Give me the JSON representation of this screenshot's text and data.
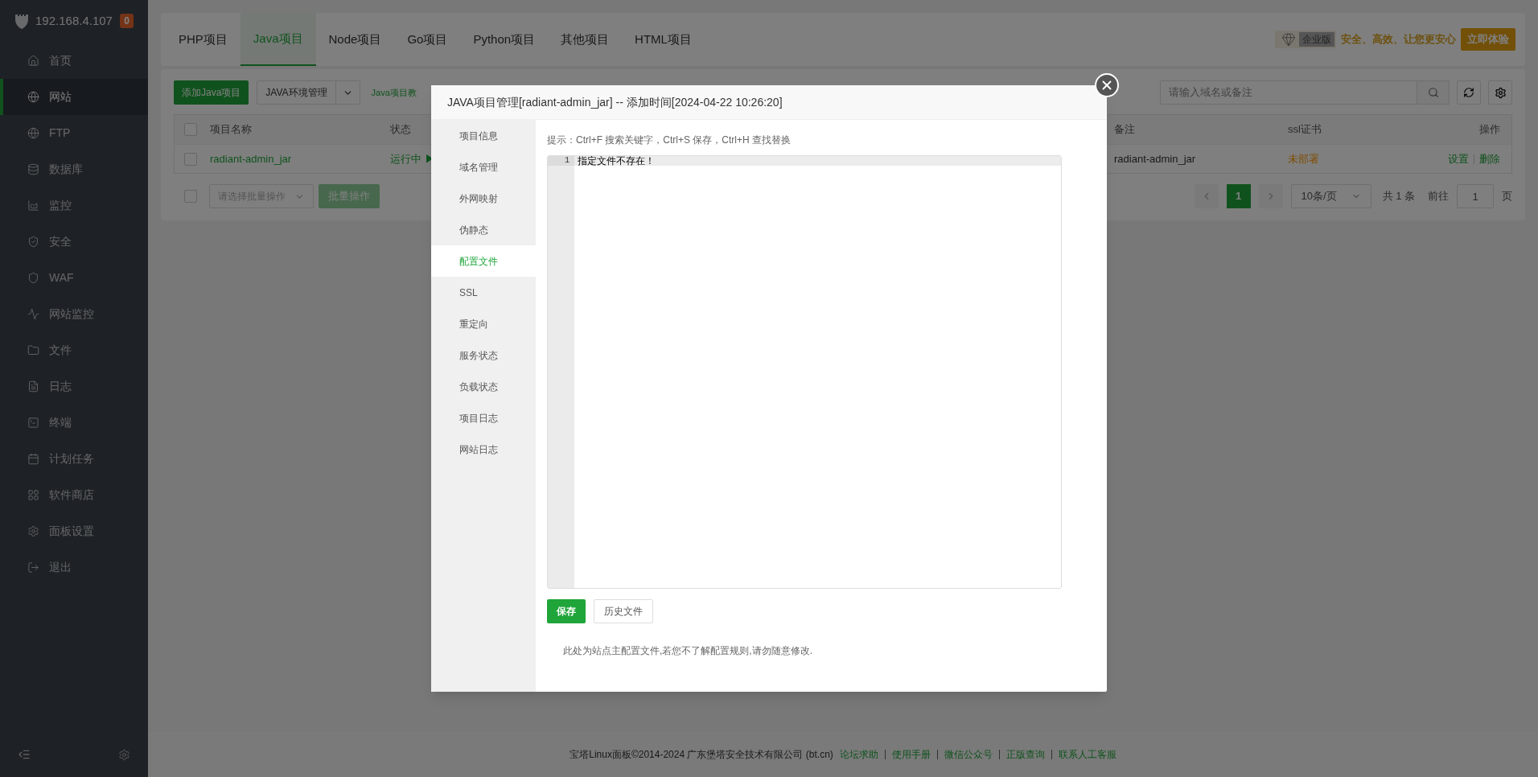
{
  "sidebar": {
    "host": "192.168.4.107",
    "badge": "0",
    "items": [
      {
        "label": "首页",
        "selected": false
      },
      {
        "label": "网站",
        "selected": true
      },
      {
        "label": "FTP",
        "selected": false
      },
      {
        "label": "数据库",
        "selected": false
      },
      {
        "label": "监控",
        "selected": false
      },
      {
        "label": "安全",
        "selected": false
      },
      {
        "label": "WAF",
        "selected": false
      },
      {
        "label": "网站监控",
        "selected": false
      },
      {
        "label": "文件",
        "selected": false
      },
      {
        "label": "日志",
        "selected": false
      },
      {
        "label": "终端",
        "selected": false
      },
      {
        "label": "计划任务",
        "selected": false
      },
      {
        "label": "软件商店",
        "selected": false
      },
      {
        "label": "面板设置",
        "selected": false
      },
      {
        "label": "退出",
        "selected": false
      }
    ]
  },
  "tabs": [
    {
      "label": "PHP项目",
      "selected": false
    },
    {
      "label": "Java项目",
      "selected": true
    },
    {
      "label": "Node项目",
      "selected": false
    },
    {
      "label": "Go项目",
      "selected": false
    },
    {
      "label": "Python项目",
      "selected": false
    },
    {
      "label": "其他项目",
      "selected": false
    },
    {
      "label": "HTML项目",
      "selected": false
    }
  ],
  "promo": {
    "edition": "企业版",
    "slogan": "安全、高效、让您更安心",
    "button": "立即体验"
  },
  "toolbar": {
    "add_button": "添加Java项目",
    "env_select": "JAVA环境管理",
    "tutorial_link": "Java项目教",
    "search_placeholder": "请输入域名或备注"
  },
  "table": {
    "all_checked": false,
    "columns": [
      "项目名称",
      "状态",
      "备注",
      "ssl证书",
      "操作"
    ],
    "rows": [
      {
        "checked": false,
        "name": "radiant-admin_jar",
        "status": "运行中 ▶",
        "remark": "radiant-admin_jar",
        "ssl": "未部署",
        "actions": [
          "设置",
          "删除"
        ]
      }
    ]
  },
  "batch": {
    "checked": false,
    "placeholder": "请选择批量操作",
    "button": "批量操作"
  },
  "pagination": {
    "pages": [
      {
        "label": "1",
        "selected": true
      }
    ],
    "page_size": "10条/页",
    "total": "共 1 条",
    "goto_label": "前往",
    "goto_value": "1",
    "page_suffix": "页"
  },
  "footer": {
    "copyright": "宝塔Linux面板©2014-2024 广东堡塔安全技术有限公司 (bt.cn)",
    "links": [
      "论坛求助",
      "使用手册",
      "微信公众号",
      "正版查询",
      "联系人工客服"
    ]
  },
  "modal": {
    "title": "JAVA项目管理[radiant-admin_jar] -- 添加时间[2024-04-22 10:26:20]",
    "menu": [
      {
        "label": "项目信息",
        "selected": false
      },
      {
        "label": "域名管理",
        "selected": false
      },
      {
        "label": "外网映射",
        "selected": false
      },
      {
        "label": "伪静态",
        "selected": false
      },
      {
        "label": "配置文件",
        "selected": true
      },
      {
        "label": "SSL",
        "selected": false
      },
      {
        "label": "重定向",
        "selected": false
      },
      {
        "label": "服务状态",
        "selected": false
      },
      {
        "label": "负载状态",
        "selected": false
      },
      {
        "label": "项目日志",
        "selected": false
      },
      {
        "label": "网站日志",
        "selected": false
      }
    ],
    "hint": "提示：Ctrl+F 搜索关键字，Ctrl+S 保存，Ctrl+H 查找替换",
    "editor": {
      "lines": [
        {
          "number": "1",
          "text": "指定文件不存在！"
        }
      ]
    },
    "buttons": [
      {
        "label": "保存",
        "kind": "primary"
      },
      {
        "label": "历史文件",
        "kind": "default"
      }
    ],
    "note": "此处为站点主配置文件,若您不了解配置规则,请勿随意修改."
  }
}
